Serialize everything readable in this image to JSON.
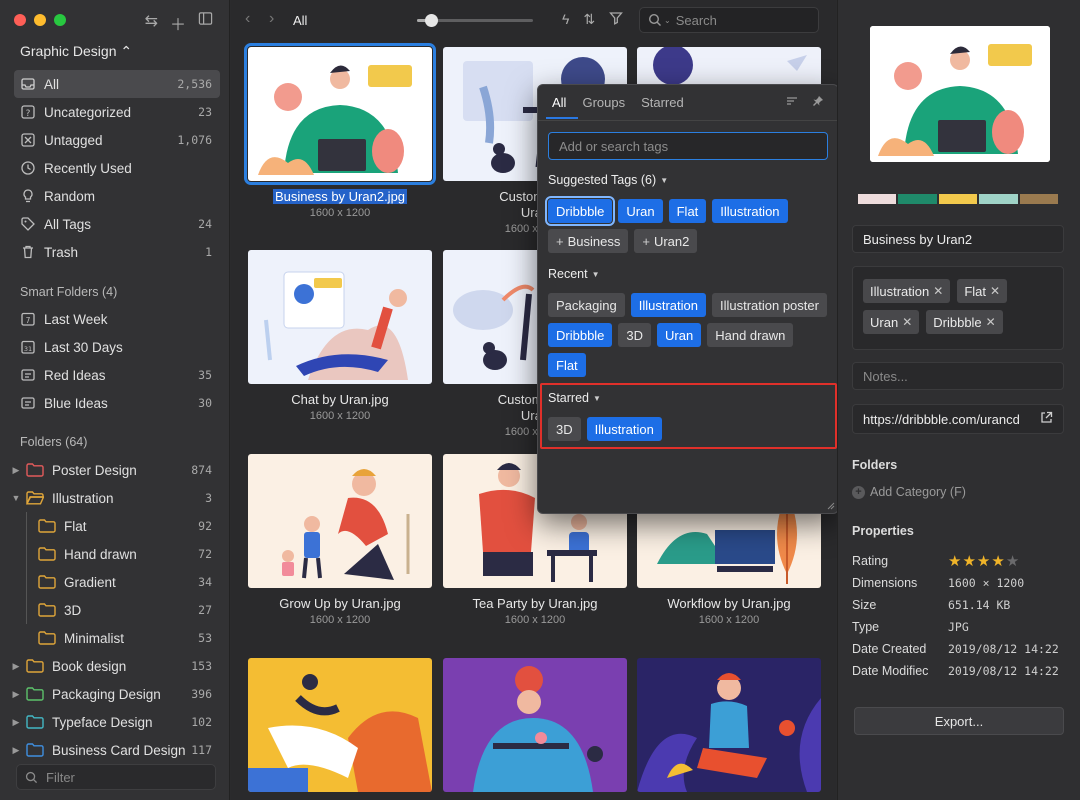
{
  "sidebar": {
    "library": "Graphic Design ⌃",
    "items": [
      {
        "label": "All",
        "count": "2,536"
      },
      {
        "label": "Uncategorized",
        "count": "23"
      },
      {
        "label": "Untagged",
        "count": "1,076"
      },
      {
        "label": "Recently Used",
        "count": ""
      },
      {
        "label": "Random",
        "count": ""
      },
      {
        "label": "All Tags",
        "count": "24"
      },
      {
        "label": "Trash",
        "count": "1"
      }
    ],
    "smart_title": "Smart Folders (4)",
    "smart": [
      {
        "label": "Last Week",
        "count": ""
      },
      {
        "label": "Last 30 Days",
        "count": ""
      },
      {
        "label": "Red Ideas",
        "count": "35"
      },
      {
        "label": "Blue Ideas",
        "count": "30"
      }
    ],
    "folders_title": "Folders (64)",
    "folders": [
      {
        "label": "Poster Design",
        "count": "874",
        "color": "#e25b5b"
      },
      {
        "label": "Illustration",
        "count": "3",
        "color": "#e0a63a"
      },
      {
        "label": "Flat",
        "count": "92",
        "color": "#e0a63a"
      },
      {
        "label": "Hand drawn",
        "count": "72",
        "color": "#e0a63a"
      },
      {
        "label": "Gradient",
        "count": "34",
        "color": "#e0a63a"
      },
      {
        "label": "3D",
        "count": "27",
        "color": "#e0a63a"
      },
      {
        "label": "Minimalist",
        "count": "53",
        "color": "#e0a63a"
      },
      {
        "label": "Book design",
        "count": "153",
        "color": "#e0a63a"
      },
      {
        "label": "Packaging Design",
        "count": "396",
        "color": "#5cc26b"
      },
      {
        "label": "Typeface Design",
        "count": "102",
        "color": "#43b7c4"
      },
      {
        "label": "Business Card Design",
        "count": "117",
        "color": "#3f8fe0"
      }
    ],
    "filter_placeholder": "Filter"
  },
  "toolbar": {
    "crumb": "All",
    "search_placeholder": "Search",
    "zoom": 0.12
  },
  "grid": [
    {
      "name": "Business by Uran2.jpg",
      "dims": "1600 x 1200"
    },
    {
      "name": "Customer At",
      "name2": "Uran",
      "dims": "1600 x 1200"
    },
    {
      "name": "Chat by Uran.jpg",
      "dims": "1600 x 1200"
    },
    {
      "name": "Customer Inf",
      "name2": "Uran",
      "dims": "1600 x 1200"
    },
    {
      "name": "Grow Up by Uran.jpg",
      "dims": "1600 x 1200"
    },
    {
      "name": "Tea Party by Uran.jpg",
      "dims": "1600 x 1200"
    },
    {
      "name": "Workflow by Uran.jpg",
      "dims": "1600 x 1200"
    }
  ],
  "popover": {
    "tabs": [
      "All",
      "Groups",
      "Starred"
    ],
    "input_placeholder": "Add or search tags",
    "suggested_title": "Suggested Tags (6)",
    "suggested": [
      {
        "label": "Dribbble",
        "style": "blue-outline"
      },
      {
        "label": "Uran",
        "style": "blue"
      },
      {
        "label": "Flat",
        "style": "blue"
      },
      {
        "label": "Illustration",
        "style": "blue"
      },
      {
        "label": "Business",
        "style": "plus"
      },
      {
        "label": "Uran2",
        "style": "plus"
      }
    ],
    "recent_title": "Recent",
    "recent": [
      {
        "label": "Packaging",
        "style": "gray"
      },
      {
        "label": "Illustration",
        "style": "blue"
      },
      {
        "label": "Illustration poster",
        "style": "gray"
      },
      {
        "label": "Dribbble",
        "style": "blue"
      },
      {
        "label": "3D",
        "style": "gray"
      },
      {
        "label": "Uran",
        "style": "blue"
      },
      {
        "label": "Hand drawn",
        "style": "gray"
      },
      {
        "label": "Flat",
        "style": "blue"
      }
    ],
    "starred_title": "Starred",
    "starred": [
      {
        "label": "3D",
        "style": "gray"
      },
      {
        "label": "Illustration",
        "style": "blue"
      }
    ]
  },
  "inspector": {
    "palette": [
      "#eedcdc",
      "#1f8a6a",
      "#f2c94c",
      "#9fd3c7",
      "#9a7a4f"
    ],
    "title": "Business by Uran2",
    "tags": [
      "Illustration",
      "Flat",
      "Uran",
      "Dribbble"
    ],
    "notes_placeholder": "Notes...",
    "url": "https://dribbble.com/urancd",
    "folders_title": "Folders",
    "add_category": "Add Category (F)",
    "properties_title": "Properties",
    "rating_label": "Rating",
    "rating": 4,
    "rating_max": 5,
    "props": [
      {
        "k": "Dimensions",
        "v": "1600 × 1200"
      },
      {
        "k": "Size",
        "v": "651.14 KB"
      },
      {
        "k": "Type",
        "v": "JPG"
      },
      {
        "k": "Date Created",
        "v": "2019/08/12 14:22"
      },
      {
        "k": "Date Modifiec",
        "v": "2019/08/12 14:22"
      }
    ],
    "export_label": "Export..."
  }
}
